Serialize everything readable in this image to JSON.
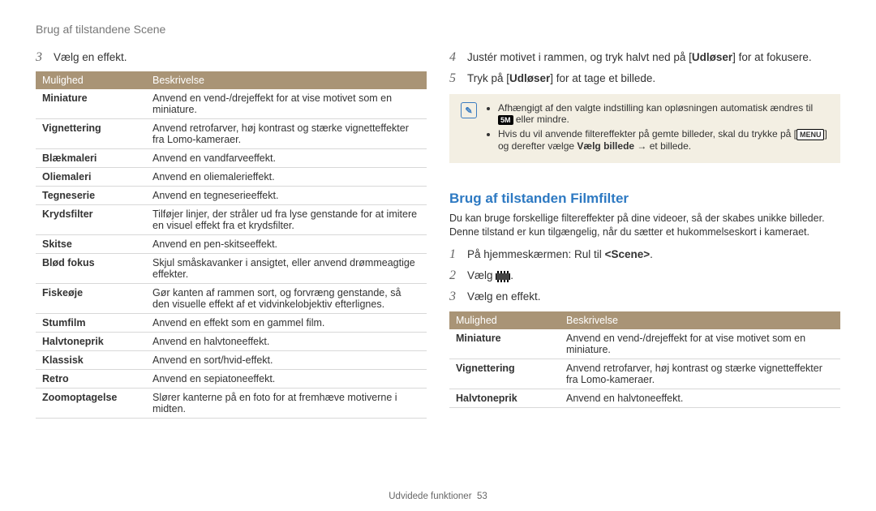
{
  "header": {
    "title": "Brug af tilstandene Scene"
  },
  "left": {
    "step3": {
      "num": "3",
      "text": "Vælg en effekt."
    },
    "table": {
      "head": {
        "c1": "Mulighed",
        "c2": "Beskrivelse"
      },
      "rows": [
        {
          "c1": "Miniature",
          "c2": "Anvend en vend-/drejeffekt for at vise motivet som en miniature."
        },
        {
          "c1": "Vignettering",
          "c2": "Anvend retrofarver, høj kontrast og stærke vignetteffekter fra Lomo-kameraer."
        },
        {
          "c1": "Blækmaleri",
          "c2": "Anvend en vandfarveeffekt."
        },
        {
          "c1": "Oliemaleri",
          "c2": "Anvend en oliemalerieffekt."
        },
        {
          "c1": "Tegneserie",
          "c2": "Anvend en tegneserieeffekt."
        },
        {
          "c1": "Krydsfilter",
          "c2": "Tilføjer linjer, der stråler ud fra lyse genstande for at imitere en visuel effekt fra et krydsfilter."
        },
        {
          "c1": "Skitse",
          "c2": "Anvend en pen-skitseeffekt."
        },
        {
          "c1": "Blød fokus",
          "c2": "Skjul småskavanker i ansigtet, eller anvend drømmeagtige effekter."
        },
        {
          "c1": "Fiskeøje",
          "c2": "Gør kanten af rammen sort, og forvræng genstande, så den visuelle effekt af et vidvinkelobjektiv efterlignes."
        },
        {
          "c1": "Stumfilm",
          "c2": "Anvend en effekt som en gammel film."
        },
        {
          "c1": "Halvtoneprik",
          "c2": "Anvend en halvtoneeffekt."
        },
        {
          "c1": "Klassisk",
          "c2": "Anvend en sort/hvid-effekt."
        },
        {
          "c1": "Retro",
          "c2": "Anvend en sepiatoneeffekt."
        },
        {
          "c1": "Zoomoptagelse",
          "c2": "Slører kanterne på en foto for at fremhæve motiverne i midten."
        }
      ]
    }
  },
  "right": {
    "step4": {
      "num": "4",
      "pre": "Justér motivet i rammen, og tryk halvt ned på [",
      "bold": "Udløser",
      "post": "] for at fokusere."
    },
    "step5": {
      "num": "5",
      "pre": "Tryk på [",
      "bold": "Udløser",
      "post": "] for at tage et billede."
    },
    "note": {
      "li1": {
        "pre": "Afhængigt af den valgte indstilling kan opløsningen automatisk ændres til ",
        "icon": "5M",
        "post": " eller mindre."
      },
      "li2": {
        "pre": "Hvis du vil anvende filtereffekter på gemte billeder, skal du trykke på [",
        "icon": "MENU",
        "post_pre": "] og derefter vælge ",
        "bold": "Vælg billede",
        "arrow": " → et billede."
      }
    },
    "subhead": "Brug af tilstanden Filmfilter",
    "intro": "Du kan bruge forskellige filtereffekter på dine videoer, så der skabes unikke billeder. Denne tilstand er kun tilgængelig, når du sætter et hukommelseskort i kameraet.",
    "step1": {
      "num": "1",
      "pre": "På hjemmeskærmen: Rul til ",
      "bold": "<Scene>",
      "post": "."
    },
    "step2": {
      "num": "2",
      "pre": "Vælg ",
      "post": "."
    },
    "step3": {
      "num": "3",
      "text": "Vælg en effekt."
    },
    "table": {
      "head": {
        "c1": "Mulighed",
        "c2": "Beskrivelse"
      },
      "rows": [
        {
          "c1": "Miniature",
          "c2": "Anvend en vend-/drejeffekt for at vise motivet som en miniature."
        },
        {
          "c1": "Vignettering",
          "c2": "Anvend retrofarver, høj kontrast og stærke vignetteffekter fra Lomo-kameraer."
        },
        {
          "c1": "Halvtoneprik",
          "c2": "Anvend en halvtoneeffekt."
        }
      ]
    }
  },
  "footer": {
    "section": "Udvidede funktioner",
    "page": "53"
  }
}
